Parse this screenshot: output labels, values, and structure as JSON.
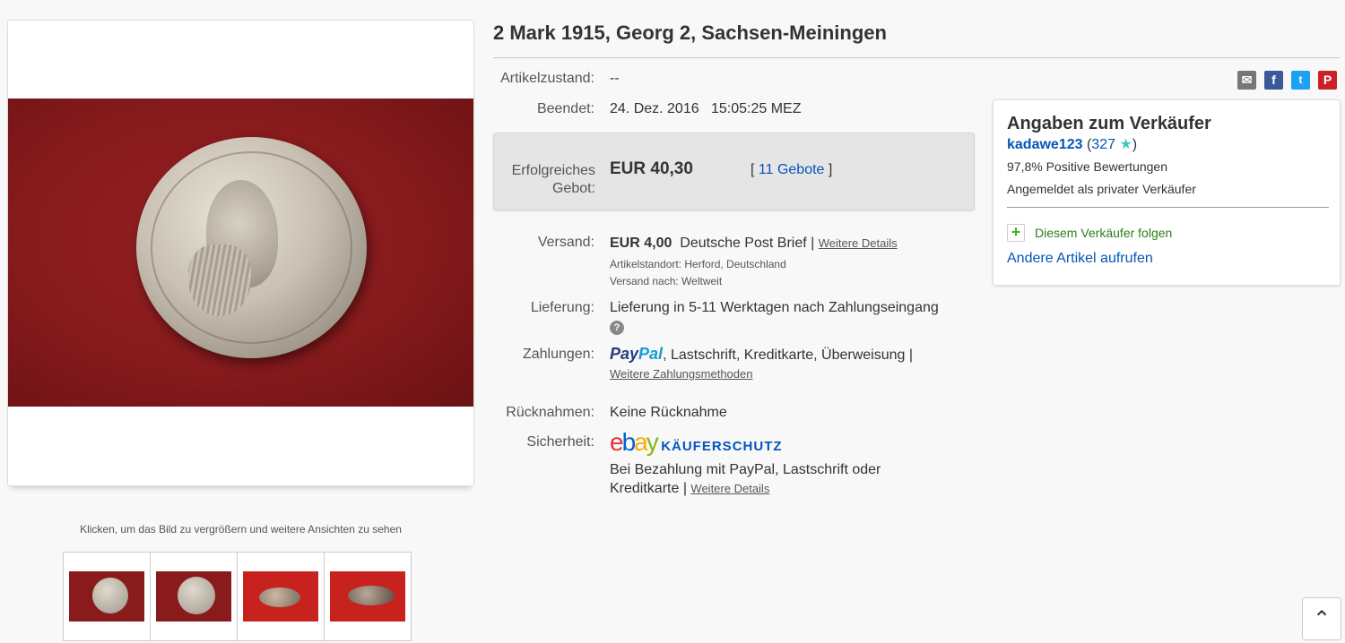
{
  "title": "2 Mark 1915, Georg 2, Sachsen-Meiningen",
  "gallery": {
    "caption": "Klicken, um das Bild zu vergrößern und weitere Ansichten zu sehen"
  },
  "details": {
    "condition_label": "Artikelzustand:",
    "condition_value": "--",
    "ended_label": "Beendet:",
    "ended_date": "24. Dez. 2016",
    "ended_time": "15:05:25 MEZ",
    "bid_label": "Erfolgreiches Gebot:",
    "bid_price": "EUR 40,30",
    "bid_open": "[",
    "bid_count": "11 Gebote",
    "bid_close": "]",
    "shipping_label": "Versand:",
    "shipping_price": "EUR 4,00",
    "shipping_service": "Deutsche Post Brief",
    "shipping_sep": "|",
    "shipping_details_link": "Weitere Details",
    "location": "Artikelstandort: Herford, Deutschland",
    "ships_to": "Versand nach: Weltweit",
    "delivery_label": "Lieferung:",
    "delivery_value": "Lieferung in 5-11 Werktagen nach Zahlungseingang",
    "payments_label": "Zahlungen:",
    "paypal_part1": "Pay",
    "paypal_part2": "Pal",
    "payments_methods": ", Lastschrift, Kreditkarte, Überweisung |",
    "payments_more_link": "Weitere Zahlungsmethoden",
    "returns_label": "Rücknahmen:",
    "returns_value": "Keine Rücknahme",
    "security_label": "Sicherheit:",
    "buyer_protection": "KÄUFERSCHUTZ",
    "security_text1": "Bei Bezahlung mit PayPal, Lastschrift oder",
    "security_text2": "Kreditkarte |",
    "security_details_link": "Weitere Details"
  },
  "seller": {
    "heading": "Angaben zum Verkäufer",
    "name": "kadawe123",
    "score": "327",
    "positive": "97,8% Positive Bewertungen",
    "type": "Angemeldet als privater Verkäufer",
    "follow": "Diesem Verkäufer folgen",
    "other_items": "Andere Artikel aufrufen"
  },
  "colors": {
    "link": "#0654ba",
    "follow_green": "#2d8016",
    "image_background": "#861a1c"
  }
}
